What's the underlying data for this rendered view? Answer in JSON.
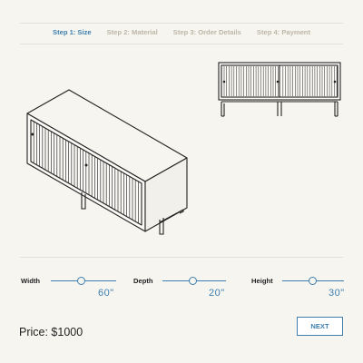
{
  "steps": [
    {
      "label": "Step 1: Size",
      "active": true
    },
    {
      "label": "Step 2: Material",
      "active": false
    },
    {
      "label": "Step 3: Order Details",
      "active": false
    },
    {
      "label": "Step 4: Payment",
      "active": false
    }
  ],
  "sliders": {
    "width": {
      "label": "Width",
      "value": "60\""
    },
    "depth": {
      "label": "Depth",
      "value": "20\""
    },
    "height": {
      "label": "Height",
      "value": "30\""
    }
  },
  "price": {
    "text": "Price: $1000"
  },
  "actions": {
    "next_label": "NEXT"
  },
  "colors": {
    "accent": "#3e7fb0",
    "muted": "#bcb6a8",
    "background": "#f7f5f0"
  }
}
